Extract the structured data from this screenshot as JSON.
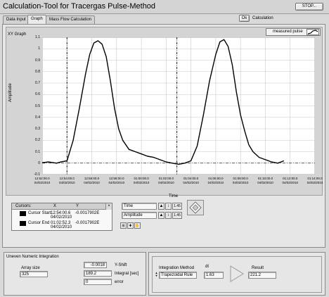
{
  "window": {
    "title": "Calculation-Tool for Tracergas Pulse-Method",
    "stop_label": "STOP..."
  },
  "ok_button": "Ok",
  "calculation_label": "Calculation",
  "tabs": [
    {
      "label": "Data Input",
      "active": false
    },
    {
      "label": "Graph",
      "active": true
    },
    {
      "label": "Mass Flow Calculation",
      "active": false
    }
  ],
  "graph": {
    "title": "XY Graph",
    "legend": "measured pulse",
    "ylabel": "Amplitude",
    "xlabel": "Time",
    "y_ticks": [
      "1.1",
      "1",
      "0.9",
      "0.8",
      "0.7",
      "0.6",
      "0.5",
      "0.4",
      "0.3",
      "0.2",
      "0.1",
      "0",
      "-0.1"
    ],
    "x_ticks": [
      {
        "time": "12:52:00.0",
        "date": "04/02/2010"
      },
      {
        "time": "12:54:00.0",
        "date": "04/02/2010"
      },
      {
        "time": "12:56:00.0",
        "date": "04/02/2010"
      },
      {
        "time": "12:58:00.0",
        "date": "04/02/2010"
      },
      {
        "time": "01:00:00.0",
        "date": "04/02/2010"
      },
      {
        "time": "01:02:00.0",
        "date": "04/02/2010"
      },
      {
        "time": "01:04:00.0",
        "date": "04/02/2010"
      },
      {
        "time": "01:06:00.0",
        "date": "04/02/2010"
      },
      {
        "time": "01:08:00.0",
        "date": "04/02/2010"
      },
      {
        "time": "01:10:00.0",
        "date": "04/02/2010"
      },
      {
        "time": "01:12:00.0",
        "date": "04/02/2010"
      },
      {
        "time": "01:14:00.0",
        "date": "04/02/2010"
      }
    ]
  },
  "chart_data": {
    "type": "line",
    "xlabel": "Time",
    "ylabel": "Amplitude",
    "ylim": [
      -0.1,
      1.1
    ],
    "xlim": [
      "12:52:00",
      "01:14:00"
    ],
    "grid": true,
    "legend_position": "top-right",
    "series": [
      {
        "name": "measured pulse",
        "x": [
          "12:51:45",
          "12:52:30",
          "12:53:10",
          "12:53:30",
          "12:54:00",
          "12:54:30",
          "12:55:00",
          "12:55:30",
          "12:55:50",
          "12:56:10",
          "12:56:30",
          "12:56:50",
          "12:57:10",
          "12:57:30",
          "12:57:50",
          "12:58:10",
          "12:58:30",
          "12:59:00",
          "12:59:30",
          "01:00:00",
          "01:00:30",
          "01:01:00",
          "01:01:30",
          "01:02:00",
          "01:02:30",
          "01:03:00",
          "01:03:30",
          "01:04:00",
          "01:04:30",
          "01:05:00",
          "01:05:30",
          "01:06:00",
          "01:06:20",
          "01:06:40",
          "01:07:00",
          "01:07:20",
          "01:07:40",
          "01:08:00",
          "01:08:20",
          "01:08:40",
          "01:09:00",
          "01:09:30",
          "01:10:00",
          "01:10:30",
          "01:11:00",
          "01:11:30"
        ],
        "y": [
          0.0,
          0.01,
          0.0,
          0.01,
          0.02,
          0.2,
          0.48,
          0.78,
          0.95,
          1.05,
          1.07,
          1.04,
          0.93,
          0.72,
          0.48,
          0.3,
          0.2,
          0.12,
          0.1,
          0.08,
          0.06,
          0.05,
          0.03,
          0.01,
          0.0,
          -0.01,
          0.0,
          0.02,
          0.15,
          0.42,
          0.72,
          0.95,
          1.06,
          1.08,
          1.02,
          0.86,
          0.62,
          0.42,
          0.28,
          0.16,
          0.1,
          0.05,
          0.03,
          0.01,
          0.0,
          0.02
        ]
      }
    ],
    "cursors": [
      {
        "name": "Cursor Start",
        "x": "12:54:00"
      },
      {
        "name": "Cursor End",
        "x": "01:02:52"
      }
    ]
  },
  "cursors": {
    "headers": [
      "Cursors:",
      "X",
      "Y"
    ],
    "rows": [
      {
        "name": "Cursor Start",
        "x": "12:54:00.6",
        "x2": "04/02/2010",
        "y": "-0.0017902E"
      },
      {
        "name": "Cursor End",
        "x": "01:02:52.3",
        "x2": "04/02/2010",
        "y": "-0.0017902E"
      }
    ]
  },
  "axis_ctrl": {
    "time": "Time",
    "amplitude": "Amplitude",
    "fmt1": "1.45",
    "fmt2": "1.45"
  },
  "integration": {
    "title": "Uneven Numeric Integration",
    "array_size_label": "Array size",
    "array_size": "325",
    "yshift_value": "-0.0018",
    "yshift_label": "Y-Shift",
    "integral_value": "189.2",
    "integral_label": "Integral [sec]",
    "error_value": "0",
    "error_label": "error"
  },
  "method": {
    "label": "Integration Method",
    "value": "Trapezoidal Rule",
    "dt_label": "dt",
    "dt_value": "1.63",
    "result_label": "Result",
    "result_value": "221.2"
  }
}
